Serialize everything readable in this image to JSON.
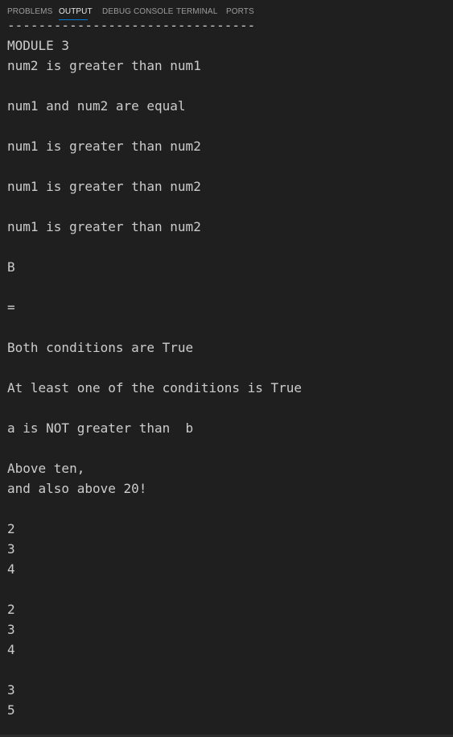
{
  "tabs": [
    {
      "label": "PROBLEMS",
      "active": false
    },
    {
      "label": "OUTPUT",
      "active": true
    },
    {
      "label": "DEBUG CONSOLE",
      "active": false
    },
    {
      "label": "TERMINAL",
      "active": false
    },
    {
      "label": "PORTS",
      "active": false
    }
  ],
  "output": {
    "lines": [
      "--------------------------------",
      "MODULE 3",
      "num2 is greater than num1",
      "",
      "num1 and num2 are equal",
      "",
      "num1 is greater than num2",
      "",
      "num1 is greater than num2",
      "",
      "num1 is greater than num2",
      "",
      "B",
      "",
      "=",
      "",
      "Both conditions are True",
      "",
      "At least one of the conditions is True",
      "",
      "a is NOT greater than  b",
      "",
      "Above ten,",
      "and also above 20!",
      "",
      "2",
      "3",
      "4",
      "",
      "2",
      "3",
      "4",
      "",
      "3",
      "5"
    ]
  },
  "colors": {
    "background": "#1f1f1f",
    "text": "#cccccc",
    "tab_inactive": "#9d9d9d",
    "tab_active": "#e7e7e7",
    "accent": "#0078d4"
  }
}
